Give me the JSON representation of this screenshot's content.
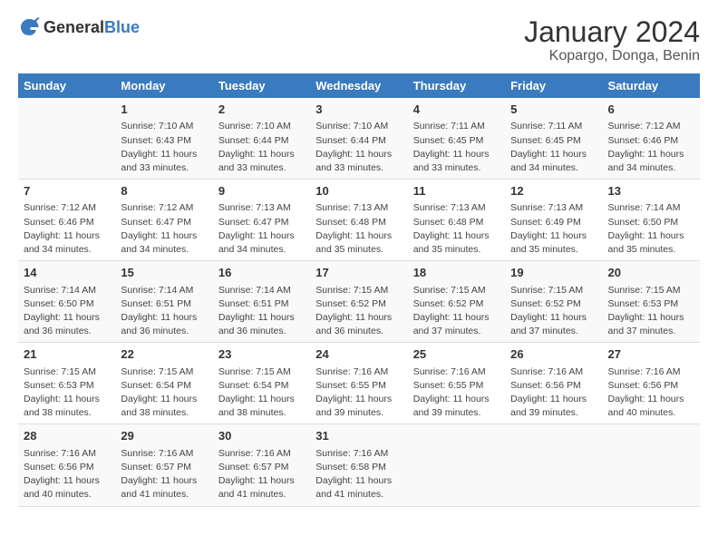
{
  "logo": {
    "general": "General",
    "blue": "Blue"
  },
  "title": "January 2024",
  "subtitle": "Kopargo, Donga, Benin",
  "days_of_week": [
    "Sunday",
    "Monday",
    "Tuesday",
    "Wednesday",
    "Thursday",
    "Friday",
    "Saturday"
  ],
  "weeks": [
    [
      {
        "day": "",
        "info": ""
      },
      {
        "day": "1",
        "info": "Sunrise: 7:10 AM\nSunset: 6:43 PM\nDaylight: 11 hours\nand 33 minutes."
      },
      {
        "day": "2",
        "info": "Sunrise: 7:10 AM\nSunset: 6:44 PM\nDaylight: 11 hours\nand 33 minutes."
      },
      {
        "day": "3",
        "info": "Sunrise: 7:10 AM\nSunset: 6:44 PM\nDaylight: 11 hours\nand 33 minutes."
      },
      {
        "day": "4",
        "info": "Sunrise: 7:11 AM\nSunset: 6:45 PM\nDaylight: 11 hours\nand 33 minutes."
      },
      {
        "day": "5",
        "info": "Sunrise: 7:11 AM\nSunset: 6:45 PM\nDaylight: 11 hours\nand 34 minutes."
      },
      {
        "day": "6",
        "info": "Sunrise: 7:12 AM\nSunset: 6:46 PM\nDaylight: 11 hours\nand 34 minutes."
      }
    ],
    [
      {
        "day": "7",
        "info": "Sunrise: 7:12 AM\nSunset: 6:46 PM\nDaylight: 11 hours\nand 34 minutes."
      },
      {
        "day": "8",
        "info": "Sunrise: 7:12 AM\nSunset: 6:47 PM\nDaylight: 11 hours\nand 34 minutes."
      },
      {
        "day": "9",
        "info": "Sunrise: 7:13 AM\nSunset: 6:47 PM\nDaylight: 11 hours\nand 34 minutes."
      },
      {
        "day": "10",
        "info": "Sunrise: 7:13 AM\nSunset: 6:48 PM\nDaylight: 11 hours\nand 35 minutes."
      },
      {
        "day": "11",
        "info": "Sunrise: 7:13 AM\nSunset: 6:48 PM\nDaylight: 11 hours\nand 35 minutes."
      },
      {
        "day": "12",
        "info": "Sunrise: 7:13 AM\nSunset: 6:49 PM\nDaylight: 11 hours\nand 35 minutes."
      },
      {
        "day": "13",
        "info": "Sunrise: 7:14 AM\nSunset: 6:50 PM\nDaylight: 11 hours\nand 35 minutes."
      }
    ],
    [
      {
        "day": "14",
        "info": "Sunrise: 7:14 AM\nSunset: 6:50 PM\nDaylight: 11 hours\nand 36 minutes."
      },
      {
        "day": "15",
        "info": "Sunrise: 7:14 AM\nSunset: 6:51 PM\nDaylight: 11 hours\nand 36 minutes."
      },
      {
        "day": "16",
        "info": "Sunrise: 7:14 AM\nSunset: 6:51 PM\nDaylight: 11 hours\nand 36 minutes."
      },
      {
        "day": "17",
        "info": "Sunrise: 7:15 AM\nSunset: 6:52 PM\nDaylight: 11 hours\nand 36 minutes."
      },
      {
        "day": "18",
        "info": "Sunrise: 7:15 AM\nSunset: 6:52 PM\nDaylight: 11 hours\nand 37 minutes."
      },
      {
        "day": "19",
        "info": "Sunrise: 7:15 AM\nSunset: 6:52 PM\nDaylight: 11 hours\nand 37 minutes."
      },
      {
        "day": "20",
        "info": "Sunrise: 7:15 AM\nSunset: 6:53 PM\nDaylight: 11 hours\nand 37 minutes."
      }
    ],
    [
      {
        "day": "21",
        "info": "Sunrise: 7:15 AM\nSunset: 6:53 PM\nDaylight: 11 hours\nand 38 minutes."
      },
      {
        "day": "22",
        "info": "Sunrise: 7:15 AM\nSunset: 6:54 PM\nDaylight: 11 hours\nand 38 minutes."
      },
      {
        "day": "23",
        "info": "Sunrise: 7:15 AM\nSunset: 6:54 PM\nDaylight: 11 hours\nand 38 minutes."
      },
      {
        "day": "24",
        "info": "Sunrise: 7:16 AM\nSunset: 6:55 PM\nDaylight: 11 hours\nand 39 minutes."
      },
      {
        "day": "25",
        "info": "Sunrise: 7:16 AM\nSunset: 6:55 PM\nDaylight: 11 hours\nand 39 minutes."
      },
      {
        "day": "26",
        "info": "Sunrise: 7:16 AM\nSunset: 6:56 PM\nDaylight: 11 hours\nand 39 minutes."
      },
      {
        "day": "27",
        "info": "Sunrise: 7:16 AM\nSunset: 6:56 PM\nDaylight: 11 hours\nand 40 minutes."
      }
    ],
    [
      {
        "day": "28",
        "info": "Sunrise: 7:16 AM\nSunset: 6:56 PM\nDaylight: 11 hours\nand 40 minutes."
      },
      {
        "day": "29",
        "info": "Sunrise: 7:16 AM\nSunset: 6:57 PM\nDaylight: 11 hours\nand 41 minutes."
      },
      {
        "day": "30",
        "info": "Sunrise: 7:16 AM\nSunset: 6:57 PM\nDaylight: 11 hours\nand 41 minutes."
      },
      {
        "day": "31",
        "info": "Sunrise: 7:16 AM\nSunset: 6:58 PM\nDaylight: 11 hours\nand 41 minutes."
      },
      {
        "day": "",
        "info": ""
      },
      {
        "day": "",
        "info": ""
      },
      {
        "day": "",
        "info": ""
      }
    ]
  ]
}
